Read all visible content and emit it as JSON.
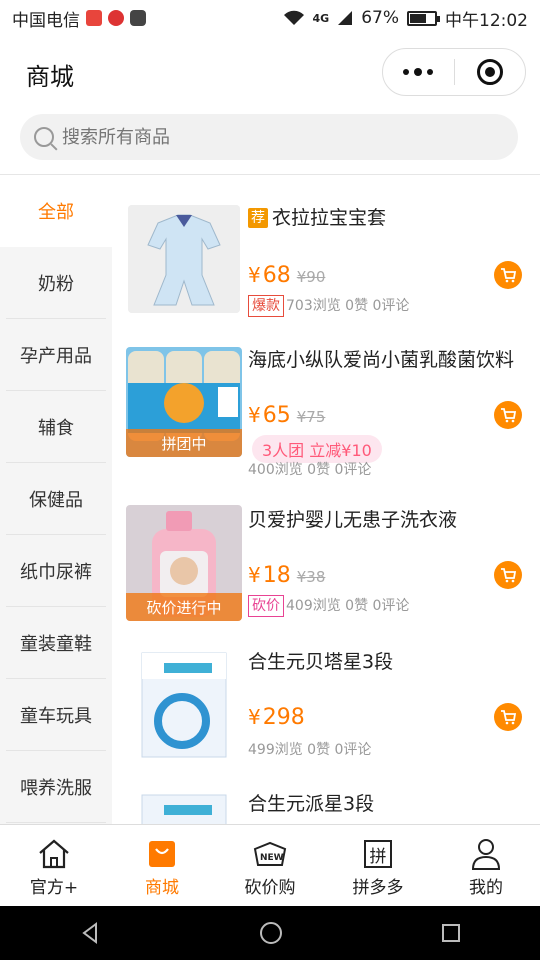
{
  "status_bar": {
    "carrier": "中国电信",
    "network": "4G",
    "battery": "67%",
    "battery_level": 0.67,
    "time": "中午12:02"
  },
  "header": {
    "title": "商城"
  },
  "search": {
    "placeholder": "搜索所有商品"
  },
  "sidebar": {
    "items": [
      {
        "label": "全部",
        "active": true
      },
      {
        "label": "奶粉"
      },
      {
        "label": "孕产用品"
      },
      {
        "label": "辅食"
      },
      {
        "label": "保健品"
      },
      {
        "label": "纸巾尿裤"
      },
      {
        "label": "童装童鞋"
      },
      {
        "label": "童车玩具"
      },
      {
        "label": "喂养洗服"
      }
    ]
  },
  "products": [
    {
      "badge": "荐",
      "name": "衣拉拉宝宝套",
      "yen": "¥",
      "price": "68",
      "old_price": "¥90",
      "tag": "爆款",
      "stats": "703浏览  0赞  0评论"
    },
    {
      "name": "海底小纵队爱尚小菌乳酸菌饮料",
      "thumb_tag": "拼团中",
      "yen": "¥",
      "price": "65",
      "old_price": "¥75",
      "group_pill": "3人团 立减¥10",
      "stats": "400浏览  0赞  0评论"
    },
    {
      "name": "贝爱护婴儿无患子洗衣液",
      "thumb_tag": "砍价进行中",
      "yen": "¥",
      "price": "18",
      "old_price": "¥38",
      "tag": "砍价",
      "stats": "409浏览  0赞  0评论"
    },
    {
      "name": "合生元贝塔星3段",
      "yen": "¥",
      "price": "298",
      "stats": "499浏览  0赞  0评论"
    },
    {
      "name": "合生元派星3段"
    }
  ],
  "tabbar": {
    "items": [
      {
        "label": "官方+",
        "icon": "home-icon"
      },
      {
        "label": "商城",
        "icon": "shopping-bag-icon",
        "active": true
      },
      {
        "label": "砍价购",
        "icon": "new-tag-icon"
      },
      {
        "label": "拼多多",
        "icon": "pin-icon",
        "icon_text": "拼"
      },
      {
        "label": "我的",
        "icon": "user-icon"
      }
    ]
  },
  "colors": {
    "accent": "#ff7a00",
    "cart": "#ff8a00",
    "sidebar_bg": "#f5f5f5"
  }
}
